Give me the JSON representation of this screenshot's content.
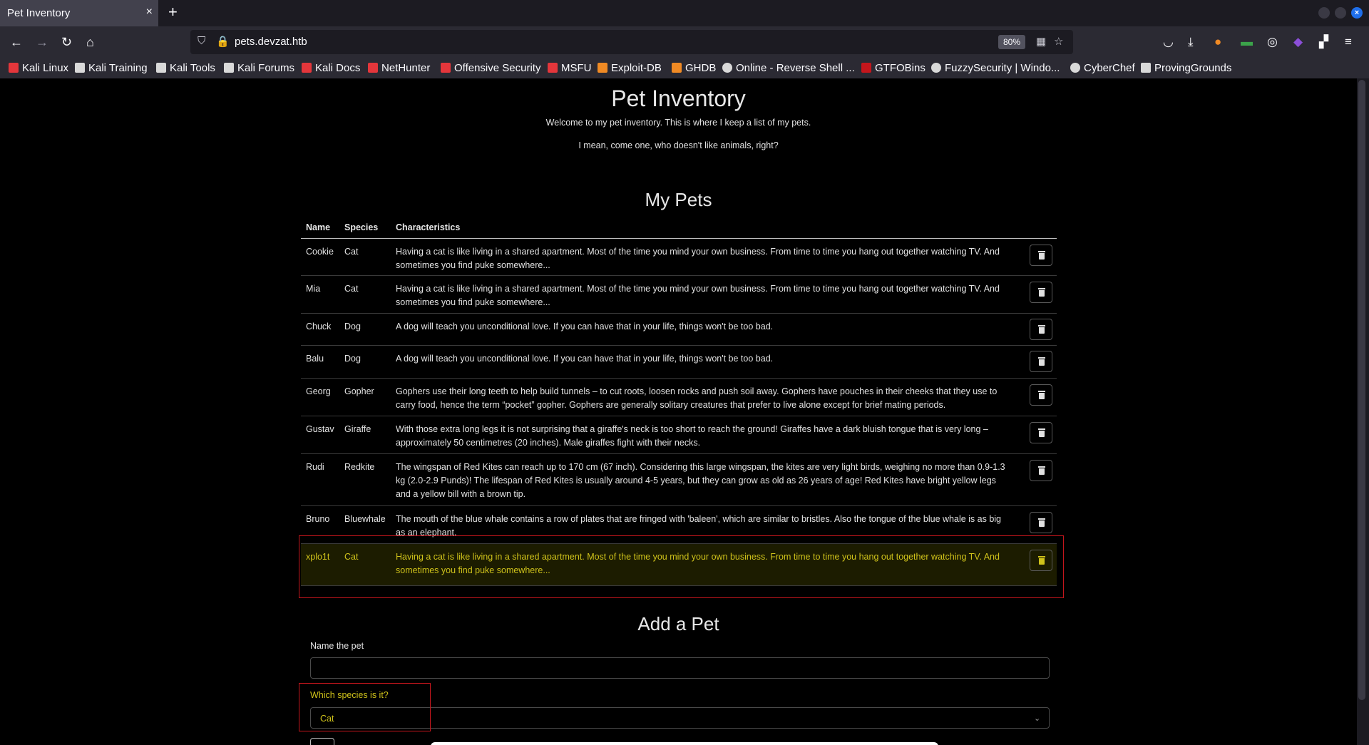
{
  "browser": {
    "tab_title": "Pet Inventory",
    "tab_close": "×",
    "new_tab": "+",
    "url": "pets.devzat.htb",
    "zoom": "80%",
    "bookmarks": [
      {
        "label": "Kali Linux",
        "color": "#e4363b"
      },
      {
        "label": "Kali Training",
        "color": "#d9d9d9"
      },
      {
        "label": "Kali Tools",
        "color": "#d9d9d9"
      },
      {
        "label": "Kali Forums",
        "color": "#d9d9d9"
      },
      {
        "label": "Kali Docs",
        "color": "#e4363b"
      },
      {
        "label": "NetHunter",
        "color": "#e4363b"
      },
      {
        "label": "Offensive Security",
        "color": "#e4363b"
      },
      {
        "label": "MSFU",
        "color": "#e4363b"
      },
      {
        "label": "Exploit-DB",
        "color": "#f08a24"
      },
      {
        "label": "GHDB",
        "color": "#f08a24"
      },
      {
        "label": "Online - Reverse Shell ...",
        "color": "#d9d9d9"
      },
      {
        "label": "GTFOBins",
        "color": "#c4161c"
      },
      {
        "label": "FuzzySecurity | Windo...",
        "color": "#d9d9d9"
      },
      {
        "label": "CyberChef",
        "color": "#d9d9d9"
      },
      {
        "label": "ProvingGrounds",
        "color": "#d9d9d9"
      }
    ]
  },
  "page": {
    "title": "Pet Inventory",
    "intro1": "Welcome to my pet inventory. This is where I keep a list of my pets.",
    "intro2": "I mean, come one, who doesn't like animals, right?",
    "pets_heading": "My Pets",
    "columns": {
      "name": "Name",
      "species": "Species",
      "characteristics": "Characteristics"
    },
    "pets": [
      {
        "name": "Cookie",
        "species": "Cat",
        "characteristics": "Having a cat is like living in a shared apartment. Most of the time you mind your own business. From time to time you hang out together watching TV. And sometimes you find puke somewhere..."
      },
      {
        "name": "Mia",
        "species": "Cat",
        "characteristics": "Having a cat is like living in a shared apartment. Most of the time you mind your own business. From time to time you hang out together watching TV. And sometimes you find puke somewhere..."
      },
      {
        "name": "Chuck",
        "species": "Dog",
        "characteristics": "A dog will teach you unconditional love. If you can have that in your life, things won't be too bad."
      },
      {
        "name": "Balu",
        "species": "Dog",
        "characteristics": "A dog will teach you unconditional love. If you can have that in your life, things won't be too bad."
      },
      {
        "name": "Georg",
        "species": "Gopher",
        "characteristics": "Gophers use their long teeth to help build tunnels – to cut roots, loosen rocks and push soil away. Gophers have pouches in their cheeks that they use to carry food, hence the term “pocket” gopher. Gophers are generally solitary creatures that prefer to live alone except for brief mating periods."
      },
      {
        "name": "Gustav",
        "species": "Giraffe",
        "characteristics": "With those extra long legs it is not surprising that a giraffe's neck is too short to reach the ground! Giraffes have a dark bluish tongue that is very long – approximately 50 centimetres (20 inches). Male giraffes fight with their necks."
      },
      {
        "name": "Rudi",
        "species": "Redkite",
        "characteristics": "The wingspan of Red Kites can reach up to 170 cm (67 inch). Considering this large wingspan, the kites are very light birds, weighing no more than 0.9-1.3 kg (2.0-2.9 Punds)! The lifespan of Red Kites is usually around 4-5 years, but they can grow as old as 26 years of age! Red Kites have bright yellow legs and a yellow bill with a brown tip."
      },
      {
        "name": "Bruno",
        "species": "Bluewhale",
        "characteristics": "The mouth of the blue whale contains a row of plates that are fringed with 'baleen', which are similar to bristles. Also the tongue of the blue whale is as big as an elephant."
      },
      {
        "name": "xplo1t",
        "species": "Cat",
        "characteristics": "Having a cat is like living in a shared apartment. Most of the time you mind your own business. From time to time you hang out together watching TV. And sometimes you find puke somewhere..."
      }
    ],
    "add_heading": "Add a Pet",
    "name_label": "Name the pet",
    "name_value": "",
    "species_label": "Which species is it?",
    "species_value": "Cat"
  }
}
